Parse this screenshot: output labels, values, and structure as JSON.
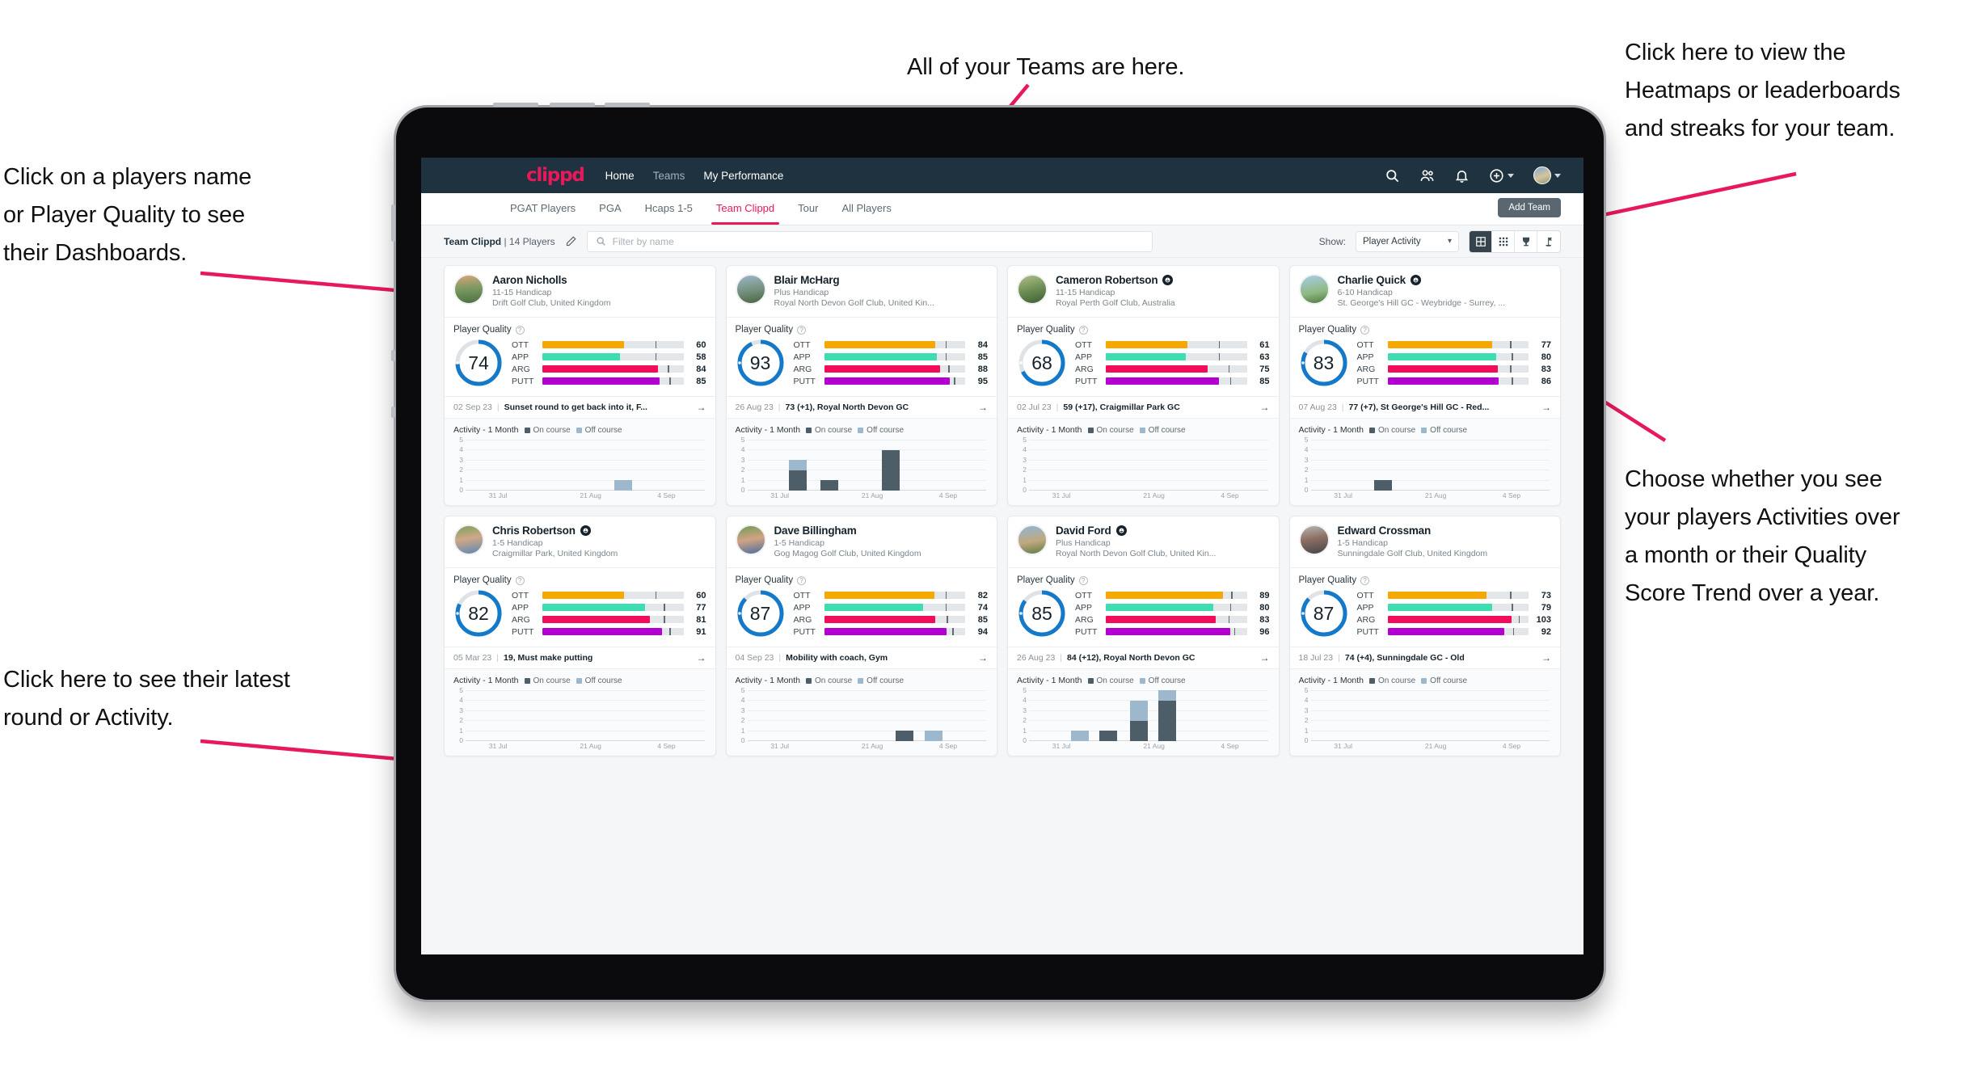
{
  "annotations": [
    {
      "id": "a-players-name",
      "lines": [
        "Click on a players name",
        "or Player Quality to see",
        "their Dashboards."
      ]
    },
    {
      "id": "a-teams",
      "lines": [
        "All of your Teams are here."
      ]
    },
    {
      "id": "a-heatmaps",
      "lines": [
        "Click here to view the",
        "Heatmaps or leaderboards",
        "and streaks for your team."
      ]
    },
    {
      "id": "a-activity-choice",
      "lines": [
        "Choose whether you see",
        "your players Activities over",
        "a month or their Quality",
        "Score Trend over a year."
      ]
    },
    {
      "id": "a-latest-round",
      "lines": [
        "Click here to see their latest",
        "round or Activity."
      ]
    }
  ],
  "app": {
    "brand": "clippd",
    "nav_links": [
      {
        "label": "Home",
        "active": true
      },
      {
        "label": "Teams",
        "active": false
      },
      {
        "label": "My Performance",
        "active": true
      }
    ],
    "nav_icons": [
      "search-icon",
      "people-icon",
      "bell-icon",
      "plus-circle-icon",
      "avatar"
    ],
    "tabs": [
      {
        "label": "PGAT Players",
        "active": false
      },
      {
        "label": "PGA",
        "active": false
      },
      {
        "label": "Hcaps 1-5",
        "active": false
      },
      {
        "label": "Team Clippd",
        "active": true
      },
      {
        "label": "Tour",
        "active": false
      },
      {
        "label": "All Players",
        "active": false
      }
    ],
    "add_team_label": "Add Team",
    "filter": {
      "team_name": "Team Clippd",
      "team_count": "14 Players",
      "edit_icon": "pencil-icon",
      "search_placeholder": "Filter by name",
      "show_label": "Show:",
      "show_value": "Player Activity",
      "show_options": [
        "Player Activity",
        "Quality Score Trend"
      ],
      "view_toggles": [
        {
          "icon": "grid-large-icon",
          "active": true
        },
        {
          "icon": "grid-small-icon",
          "active": false
        },
        {
          "icon": "trophy-icon",
          "active": false
        },
        {
          "icon": "golf-flag-icon",
          "active": false
        }
      ]
    }
  },
  "colors": {
    "brand_pink": "#e8195b",
    "navbar": "#1e323f",
    "ring": "#1479c9",
    "ott": "#f5a800",
    "app": "#3edcb0",
    "arg": "#f20d5a",
    "putt": "#b300d0",
    "on_course": "#4e5e69",
    "off_course": "#9db7cd"
  },
  "chart_common": {
    "legend": [
      "On course",
      "Off course"
    ],
    "activity_title": "Activity - 1 Month",
    "player_quality_title": "Player Quality",
    "ylim": [
      0,
      5
    ],
    "yticks": [
      0,
      1,
      2,
      3,
      4,
      5
    ],
    "xticks": [
      "31 Jul",
      "21 Aug",
      "4 Sep"
    ],
    "type": "bar"
  },
  "players": [
    {
      "name": "Aaron Nicholls",
      "verified": false,
      "avatar_class": "av0",
      "handicap": "11-15 Handicap",
      "club": "Drift Golf Club, United Kingdom",
      "quality": 74,
      "metrics": [
        {
          "label": "OTT",
          "value": 60,
          "fill_pct": 58,
          "tick_pct": 80,
          "color": "#f5a800"
        },
        {
          "label": "APP",
          "value": 58,
          "fill_pct": 55,
          "tick_pct": 80,
          "color": "#3edcb0"
        },
        {
          "label": "ARG",
          "value": 84,
          "fill_pct": 82,
          "tick_pct": 89,
          "color": "#f20d5a"
        },
        {
          "label": "PUTT",
          "value": 85,
          "fill_pct": 83,
          "tick_pct": 90,
          "color": "#b300d0"
        }
      ],
      "latest_date": "02 Sep 23",
      "latest_text": "Sunset round to get back into it, F...",
      "chart_data": {
        "type": "bar",
        "title": "Activity - 1 Month",
        "categories": [
          "31 Jul",
          "21 Aug",
          "4 Sep"
        ],
        "ylim": [
          0,
          5
        ],
        "series": [
          {
            "name": "On course",
            "color": "#4e5e69"
          },
          {
            "name": "Off course",
            "color": "#9db7cd"
          }
        ],
        "bars": [
          {
            "x_pct": 62,
            "on": 0,
            "off": 1
          }
        ]
      }
    },
    {
      "name": "Blair McHarg",
      "verified": false,
      "avatar_class": "av1",
      "handicap": "Plus Handicap",
      "club": "Royal North Devon Golf Club, United Kin...",
      "quality": 93,
      "metrics": [
        {
          "label": "OTT",
          "value": 84,
          "fill_pct": 79,
          "tick_pct": 86,
          "color": "#f5a800"
        },
        {
          "label": "APP",
          "value": 85,
          "fill_pct": 80,
          "tick_pct": 86,
          "color": "#3edcb0"
        },
        {
          "label": "ARG",
          "value": 88,
          "fill_pct": 82,
          "tick_pct": 88,
          "color": "#f20d5a"
        },
        {
          "label": "PUTT",
          "value": 95,
          "fill_pct": 89,
          "tick_pct": 92,
          "color": "#b300d0"
        }
      ],
      "latest_date": "26 Aug 23",
      "latest_text": "73 (+1), Royal North Devon GC",
      "chart_data": {
        "type": "bar",
        "title": "Activity - 1 Month",
        "categories": [
          "31 Jul",
          "21 Aug",
          "4 Sep"
        ],
        "ylim": [
          0,
          5
        ],
        "series": [
          {
            "name": "On course",
            "color": "#4e5e69"
          },
          {
            "name": "Off course",
            "color": "#9db7cd"
          }
        ],
        "bars": [
          {
            "x_pct": 17,
            "on": 2,
            "off": 1
          },
          {
            "x_pct": 30,
            "on": 1,
            "off": 0
          },
          {
            "x_pct": 56,
            "on": 4,
            "off": 0
          }
        ]
      }
    },
    {
      "name": "Cameron Robertson",
      "verified": true,
      "avatar_class": "av2",
      "handicap": "11-15 Handicap",
      "club": "Royal Perth Golf Club, Australia",
      "quality": 68,
      "metrics": [
        {
          "label": "OTT",
          "value": 61,
          "fill_pct": 58,
          "tick_pct": 80,
          "color": "#f5a800"
        },
        {
          "label": "APP",
          "value": 63,
          "fill_pct": 57,
          "tick_pct": 80,
          "color": "#3edcb0"
        },
        {
          "label": "ARG",
          "value": 75,
          "fill_pct": 72,
          "tick_pct": 87,
          "color": "#f20d5a"
        },
        {
          "label": "PUTT",
          "value": 85,
          "fill_pct": 80,
          "tick_pct": 88,
          "color": "#b300d0"
        }
      ],
      "latest_date": "02 Jul 23",
      "latest_text": "59 (+17), Craigmillar Park GC",
      "chart_data": {
        "type": "bar",
        "title": "Activity - 1 Month",
        "categories": [
          "31 Jul",
          "21 Aug",
          "4 Sep"
        ],
        "ylim": [
          0,
          5
        ],
        "series": [
          {
            "name": "On course",
            "color": "#4e5e69"
          },
          {
            "name": "Off course",
            "color": "#9db7cd"
          }
        ],
        "bars": []
      }
    },
    {
      "name": "Charlie Quick",
      "verified": true,
      "avatar_class": "av3",
      "handicap": "6-10 Handicap",
      "club": "St. George's Hill GC - Weybridge - Surrey, ...",
      "quality": 83,
      "metrics": [
        {
          "label": "OTT",
          "value": 77,
          "fill_pct": 74,
          "tick_pct": 87,
          "color": "#f5a800"
        },
        {
          "label": "APP",
          "value": 80,
          "fill_pct": 77,
          "tick_pct": 88,
          "color": "#3edcb0"
        },
        {
          "label": "ARG",
          "value": 83,
          "fill_pct": 78,
          "tick_pct": 87,
          "color": "#f20d5a"
        },
        {
          "label": "PUTT",
          "value": 86,
          "fill_pct": 79,
          "tick_pct": 88,
          "color": "#b300d0"
        }
      ],
      "latest_date": "07 Aug 23",
      "latest_text": "77 (+7), St George's Hill GC - Red...",
      "chart_data": {
        "type": "bar",
        "title": "Activity - 1 Month",
        "categories": [
          "31 Jul",
          "21 Aug",
          "4 Sep"
        ],
        "ylim": [
          0,
          5
        ],
        "series": [
          {
            "name": "On course",
            "color": "#4e5e69"
          },
          {
            "name": "Off course",
            "color": "#9db7cd"
          }
        ],
        "bars": [
          {
            "x_pct": 26,
            "on": 1,
            "off": 0
          }
        ]
      }
    },
    {
      "name": "Chris Robertson",
      "verified": true,
      "avatar_class": "av4",
      "handicap": "1-5 Handicap",
      "club": "Craigmillar Park, United Kingdom",
      "quality": 82,
      "metrics": [
        {
          "label": "OTT",
          "value": 60,
          "fill_pct": 58,
          "tick_pct": 80,
          "color": "#f5a800"
        },
        {
          "label": "APP",
          "value": 77,
          "fill_pct": 73,
          "tick_pct": 86,
          "color": "#3edcb0"
        },
        {
          "label": "ARG",
          "value": 81,
          "fill_pct": 76,
          "tick_pct": 86,
          "color": "#f20d5a"
        },
        {
          "label": "PUTT",
          "value": 91,
          "fill_pct": 85,
          "tick_pct": 90,
          "color": "#b300d0"
        }
      ],
      "latest_date": "05 Mar 23",
      "latest_text": "19, Must make putting",
      "chart_data": {
        "type": "bar",
        "title": "Activity - 1 Month",
        "categories": [
          "31 Jul",
          "21 Aug",
          "4 Sep"
        ],
        "ylim": [
          0,
          5
        ],
        "series": [
          {
            "name": "On course",
            "color": "#4e5e69"
          },
          {
            "name": "Off course",
            "color": "#9db7cd"
          }
        ],
        "bars": []
      }
    },
    {
      "name": "Dave Billingham",
      "verified": false,
      "avatar_class": "av5",
      "handicap": "1-5 Handicap",
      "club": "Gog Magog Golf Club, United Kingdom",
      "quality": 87,
      "metrics": [
        {
          "label": "OTT",
          "value": 82,
          "fill_pct": 78,
          "tick_pct": 86,
          "color": "#f5a800"
        },
        {
          "label": "APP",
          "value": 74,
          "fill_pct": 70,
          "tick_pct": 86,
          "color": "#3edcb0"
        },
        {
          "label": "ARG",
          "value": 85,
          "fill_pct": 79,
          "tick_pct": 87,
          "color": "#f20d5a"
        },
        {
          "label": "PUTT",
          "value": 94,
          "fill_pct": 87,
          "tick_pct": 91,
          "color": "#b300d0"
        }
      ],
      "latest_date": "04 Sep 23",
      "latest_text": "Mobility with coach, Gym",
      "chart_data": {
        "type": "bar",
        "title": "Activity - 1 Month",
        "categories": [
          "31 Jul",
          "21 Aug",
          "4 Sep"
        ],
        "ylim": [
          0,
          5
        ],
        "series": [
          {
            "name": "On course",
            "color": "#4e5e69"
          },
          {
            "name": "Off course",
            "color": "#9db7cd"
          }
        ],
        "bars": [
          {
            "x_pct": 62,
            "on": 1,
            "off": 0
          },
          {
            "x_pct": 74,
            "on": 0,
            "off": 1
          }
        ]
      }
    },
    {
      "name": "David Ford",
      "verified": true,
      "avatar_class": "av6",
      "handicap": "Plus Handicap",
      "club": "Royal North Devon Golf Club, United Kin...",
      "quality": 85,
      "metrics": [
        {
          "label": "OTT",
          "value": 89,
          "fill_pct": 83,
          "tick_pct": 89,
          "color": "#f5a800"
        },
        {
          "label": "APP",
          "value": 80,
          "fill_pct": 76,
          "tick_pct": 88,
          "color": "#3edcb0"
        },
        {
          "label": "ARG",
          "value": 83,
          "fill_pct": 78,
          "tick_pct": 87,
          "color": "#f20d5a"
        },
        {
          "label": "PUTT",
          "value": 96,
          "fill_pct": 88,
          "tick_pct": 91,
          "color": "#b300d0"
        }
      ],
      "latest_date": "26 Aug 23",
      "latest_text": "84 (+12), Royal North Devon GC",
      "chart_data": {
        "type": "bar",
        "title": "Activity - 1 Month",
        "categories": [
          "31 Jul",
          "21 Aug",
          "4 Sep"
        ],
        "ylim": [
          0,
          5
        ],
        "series": [
          {
            "name": "On course",
            "color": "#4e5e69"
          },
          {
            "name": "Off course",
            "color": "#9db7cd"
          }
        ],
        "bars": [
          {
            "x_pct": 17,
            "on": 0,
            "off": 1
          },
          {
            "x_pct": 29,
            "on": 1,
            "off": 0
          },
          {
            "x_pct": 42,
            "on": 2,
            "off": 2
          },
          {
            "x_pct": 54,
            "on": 4,
            "off": 1
          }
        ]
      }
    },
    {
      "name": "Edward Crossman",
      "verified": false,
      "avatar_class": "av7",
      "handicap": "1-5 Handicap",
      "club": "Sunningdale Golf Club, United Kingdom",
      "quality": 87,
      "metrics": [
        {
          "label": "OTT",
          "value": 73,
          "fill_pct": 70,
          "tick_pct": 87,
          "color": "#f5a800"
        },
        {
          "label": "APP",
          "value": 79,
          "fill_pct": 74,
          "tick_pct": 88,
          "color": "#3edcb0"
        },
        {
          "label": "ARG",
          "value": 103,
          "fill_pct": 88,
          "tick_pct": 93,
          "color": "#f20d5a"
        },
        {
          "label": "PUTT",
          "value": 92,
          "fill_pct": 83,
          "tick_pct": 89,
          "color": "#b300d0"
        }
      ],
      "latest_date": "18 Jul 23",
      "latest_text": "74 (+4), Sunningdale GC - Old",
      "chart_data": {
        "type": "bar",
        "title": "Activity - 1 Month",
        "categories": [
          "31 Jul",
          "21 Aug",
          "4 Sep"
        ],
        "ylim": [
          0,
          5
        ],
        "series": [
          {
            "name": "On course",
            "color": "#4e5e69"
          },
          {
            "name": "Off course",
            "color": "#9db7cd"
          }
        ],
        "bars": []
      }
    }
  ]
}
